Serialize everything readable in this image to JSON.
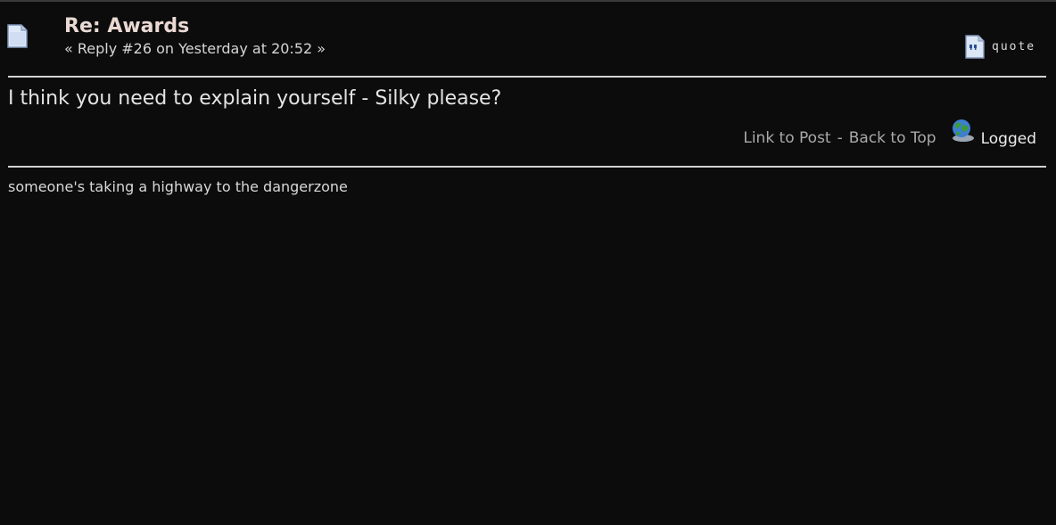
{
  "post": {
    "title": "Re: Awards",
    "reply_meta": "« Reply #26 on Yesterday at 20:52 »",
    "quote_label": "quote",
    "message": "I think you need to explain yourself - Silky please?",
    "link_to_post": "Link to Post",
    "separator": "-",
    "back_to_top": "Back to Top",
    "logged_label": "Logged",
    "signature": "someone's taking a highway to the dangerzone"
  },
  "icons": {
    "post": "document-icon",
    "quote": "quote-icon",
    "logged": "globe-icon"
  },
  "colors": {
    "background": "#0c0c0c",
    "title": "#ead9d3",
    "link": "#a9a9a9",
    "rule": "#d2d2d2"
  }
}
